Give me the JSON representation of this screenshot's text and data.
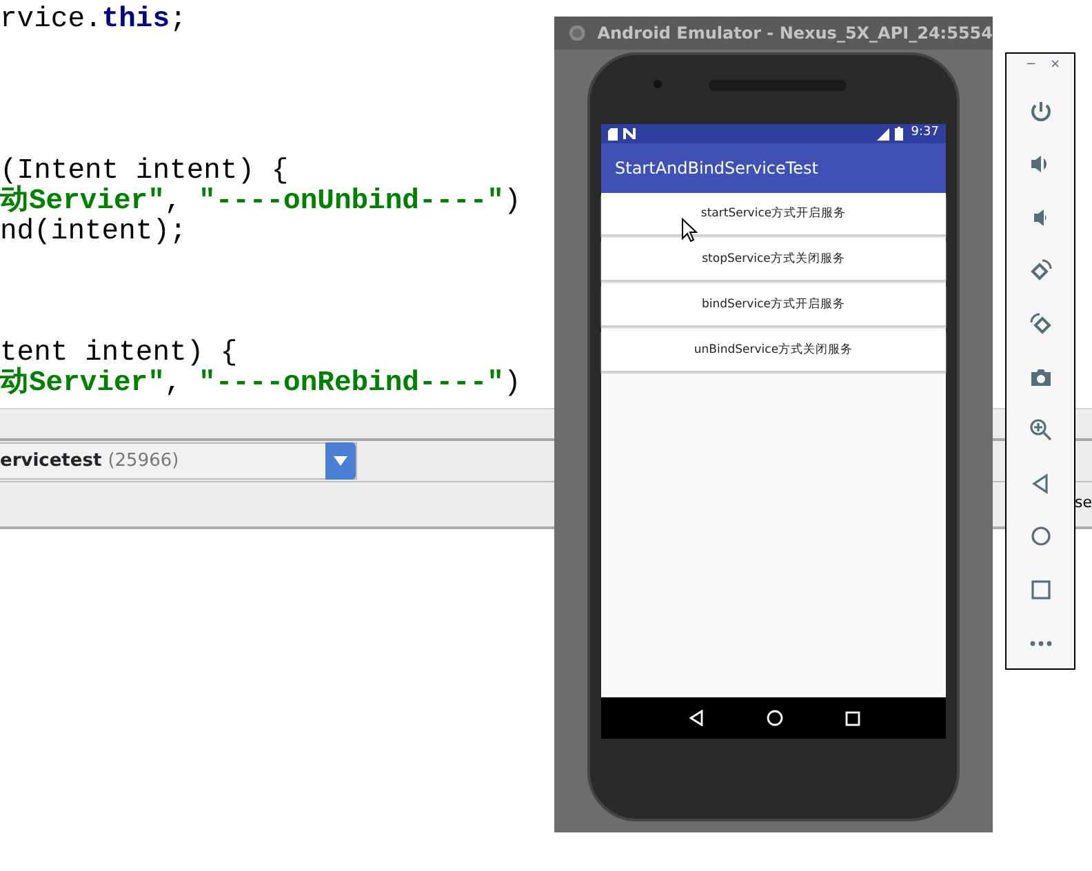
{
  "editor": {
    "code_blocks": [
      [
        [
          {
            "kind": "plain",
            "text": "rvice."
          },
          {
            "kind": "keyword",
            "text": "this"
          },
          {
            "kind": "plain",
            "text": ";"
          }
        ]
      ],
      [
        [
          {
            "kind": "plain",
            "text": "(Intent intent) {"
          }
        ],
        [
          {
            "kind": "string",
            "text": "动Servier\""
          },
          {
            "kind": "plain",
            "text": ", "
          },
          {
            "kind": "string",
            "text": "\"----onUnbind----\""
          },
          {
            "kind": "plain",
            "text": ")"
          }
        ],
        [
          {
            "kind": "plain",
            "text": "nd(intent);"
          }
        ]
      ],
      [
        [
          {
            "kind": "plain",
            "text": "tent intent) {"
          }
        ],
        [
          {
            "kind": "string",
            "text": "动Servier\""
          },
          {
            "kind": "plain",
            "text": ", "
          },
          {
            "kind": "string",
            "text": "\"----onRebind----\""
          },
          {
            "kind": "plain",
            "text": ")"
          }
        ]
      ]
    ]
  },
  "process_select": {
    "name": "ervicetest",
    "pid": "(25966)"
  },
  "side_text": "se",
  "emulator": {
    "title": "Android Emulator - Nexus_5X_API_24:5554",
    "status_bar": {
      "time": "9:37"
    },
    "app_title": "StartAndBindServiceTest",
    "buttons": [
      "startService方式开启服务",
      "stopService方式关闭服务",
      "bindService方式开启服务",
      "unBindService方式关闭服务"
    ]
  },
  "toolbar": {
    "minimize": "−",
    "close": "×"
  }
}
